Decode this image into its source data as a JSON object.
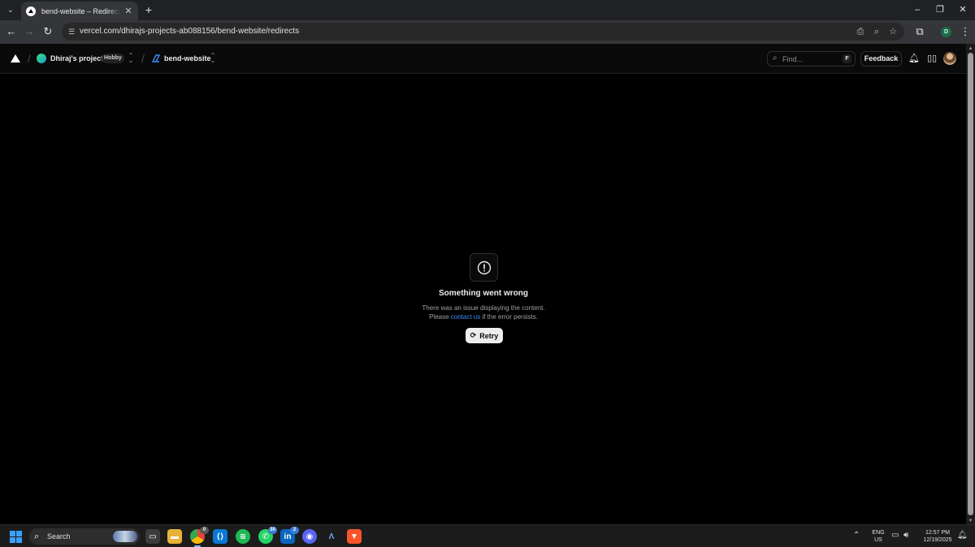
{
  "browser": {
    "tab_title": "bend-website – Redirects – Vercel",
    "url": "vercel.com/dhirajs-projects-ab088156/bend-website/redirects",
    "profile_initial": "D"
  },
  "header": {
    "team_name": "Dhiraj's projects",
    "plan_badge": "Hobby",
    "project_name": "bend-website",
    "search_placeholder": "Find...",
    "search_shortcut": "F",
    "feedback_label": "Feedback"
  },
  "error": {
    "title": "Something went wrong",
    "line1": "There was an issue displaying the content.",
    "line2_prefix": "Please ",
    "link_text": "contact us",
    "line2_suffix": " if the error persists.",
    "retry_label": "Retry"
  },
  "taskbar": {
    "search_label": "Search",
    "whatsapp_badge": "30",
    "linkedin_badge": "2",
    "chrome_badge": "0",
    "lang_line1": "ENG",
    "lang_line2": "US",
    "time": "12:57 PM",
    "date": "12/19/2025"
  },
  "colors": {
    "accent_link": "#3b8cf6",
    "page_background": "#000000"
  }
}
